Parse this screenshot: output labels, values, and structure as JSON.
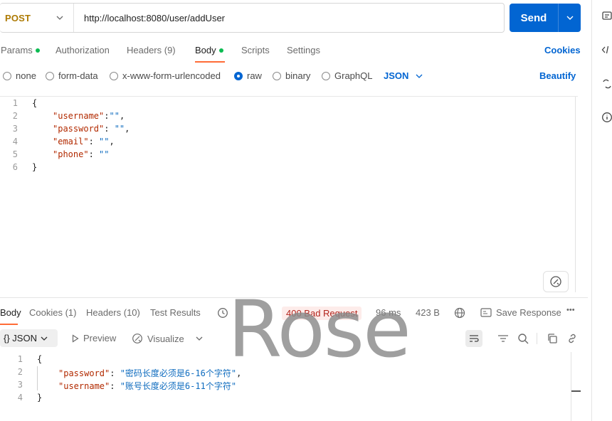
{
  "request": {
    "method": "POST",
    "url": "http://localhost:8080/user/addUser",
    "send_label": "Send"
  },
  "tabs": [
    {
      "label": "Params",
      "dot": true
    },
    {
      "label": "Authorization",
      "dot": false
    },
    {
      "label": "Headers (9)",
      "dot": false
    },
    {
      "label": "Body",
      "dot": true,
      "active": true
    },
    {
      "label": "Scripts",
      "dot": false
    },
    {
      "label": "Settings",
      "dot": false
    }
  ],
  "cookies_label": "Cookies",
  "body_types": [
    {
      "label": "none",
      "selected": false
    },
    {
      "label": "form-data",
      "selected": false
    },
    {
      "label": "x-www-form-urlencoded",
      "selected": false
    },
    {
      "label": "raw",
      "selected": true
    },
    {
      "label": "binary",
      "selected": false
    },
    {
      "label": "GraphQL",
      "selected": false
    }
  ],
  "raw_format": "JSON",
  "beautify_label": "Beautify",
  "request_body": {
    "line_numbers": [
      "1",
      "2",
      "3",
      "4",
      "5",
      "6"
    ],
    "open_brace": "{",
    "close_brace": "}",
    "fields": [
      {
        "key": "\"username\"",
        "sep": ":",
        "value": "\"\"",
        "comma": ","
      },
      {
        "key": "\"password\"",
        "sep": ": ",
        "value": "\"\"",
        "comma": ","
      },
      {
        "key": "\"email\"",
        "sep": ": ",
        "value": "\"\"",
        "comma": ","
      },
      {
        "key": "\"phone\"",
        "sep": ": ",
        "value": "\"\"",
        "comma": ""
      }
    ]
  },
  "response_tabs": [
    {
      "label": "Body",
      "active": true
    },
    {
      "label": "Cookies (1)",
      "active": false
    },
    {
      "label": "Headers (10)",
      "active": false
    },
    {
      "label": "Test Results",
      "active": false
    }
  ],
  "response_meta": {
    "status": "400 Bad Request",
    "time": "96 ms",
    "size": "423 B",
    "save_label": "Save Response",
    "more": "•••"
  },
  "response_toolbar": {
    "format": "{} JSON",
    "preview": "Preview",
    "visualize": "Visualize"
  },
  "response_body": {
    "line_numbers": [
      "1",
      "2",
      "3",
      "4"
    ],
    "open_brace": "{",
    "close_brace": "}",
    "fields": [
      {
        "key": "\"password\"",
        "sep": ": ",
        "value": "\"密码长度必须是6-16个字符\"",
        "comma": ","
      },
      {
        "key": "\"username\"",
        "sep": ": ",
        "value": "\"账号长度必须是6-11个字符\"",
        "comma": ""
      }
    ]
  },
  "watermark": "Rose",
  "colors": {
    "method": "#ad7a03",
    "send": "#0265d2",
    "accent_link": "#0265d2",
    "tab_underline": "#ff6c37",
    "dot": "#0cbb52",
    "status_bg": "#fdecea",
    "status_text": "#b3261e",
    "json_key": "#b22a00",
    "json_string": "#0f6cbf"
  }
}
